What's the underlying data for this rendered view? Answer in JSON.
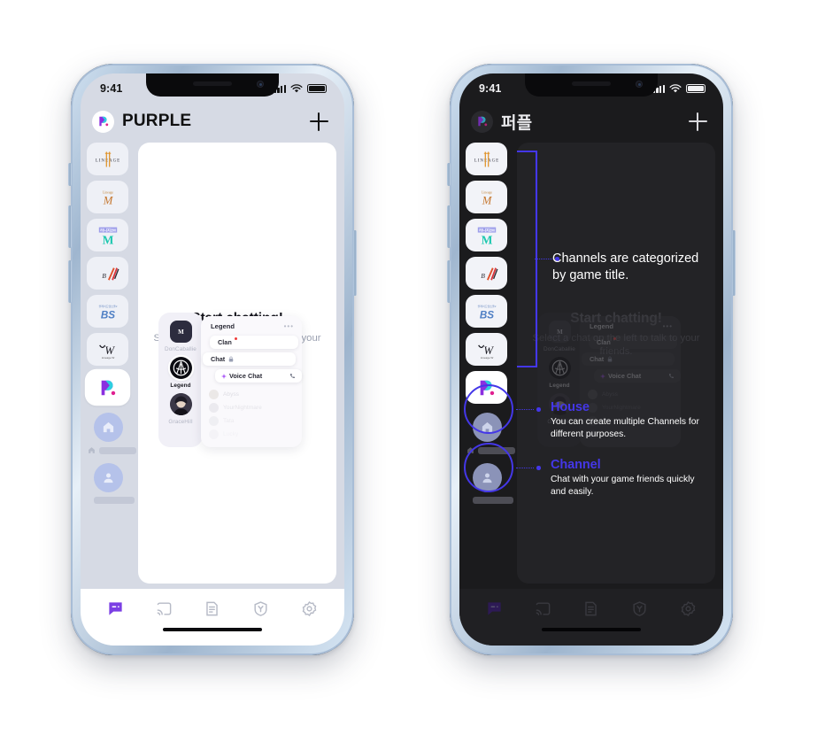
{
  "meta": {
    "accent_purple": "#7b3fe4",
    "accent_blue": "#4437e8",
    "light_bg": "#d6dae4",
    "dark_bg": "#1b1b1d"
  },
  "phones": [
    {
      "id": "light",
      "theme": "light",
      "status": {
        "time": "9:41",
        "signal_icon": "cellular-bars-icon",
        "wifi_icon": "wifi-icon",
        "battery_icon": "battery-icon"
      },
      "header": {
        "logo_icon": "purple-app-logo-icon",
        "title": "PURPLE",
        "add_icon": "plus-icon"
      },
      "rail": {
        "games": [
          {
            "name": "lineage",
            "label": "LINEAGE"
          },
          {
            "name": "lineage-m",
            "label": "Lineage M"
          },
          {
            "name": "lineage-2m",
            "label": "Lineage 2M"
          },
          {
            "name": "blade-and-soul",
            "label": "Blade & Soul"
          },
          {
            "name": "b-and-s-2",
            "label": "BS2"
          },
          {
            "name": "lineage-w",
            "label": "Lineage W"
          },
          {
            "name": "purple",
            "label": "PURPLE",
            "selected": true
          }
        ],
        "placeholders": [
          {
            "name": "house",
            "icon": "house-icon"
          },
          {
            "name": "channel",
            "icon": "person-icon"
          }
        ]
      },
      "empty_state": {
        "title": "Start chatting!",
        "body": "Select a chat on the left to talk to your friends."
      },
      "overlay": {
        "friends": [
          {
            "name": "DonCaballie",
            "avatar": "m-badge-avatar",
            "selected": false
          },
          {
            "name": "Legend",
            "avatar": "legend-crest-avatar",
            "selected": true
          },
          {
            "name": "GraceHill",
            "avatar": "gracehill-photo-avatar",
            "selected": false
          }
        ],
        "panel_title": "Legend",
        "more_icon": "more-horizontal-icon",
        "channels": [
          {
            "label": "Clan",
            "badge": true,
            "icon": null
          },
          {
            "label": "Chat",
            "badge": false,
            "icon": "lock-icon"
          },
          {
            "label": "Voice Chat",
            "badge": false,
            "icon": "sparkle-icon",
            "trailing_icon": "phone-call-icon"
          }
        ],
        "members": [
          "Abyss",
          "YourNightmare",
          "Tata",
          "Lucky"
        ]
      },
      "tabs": [
        {
          "name": "chat",
          "icon": "chat-bubble-icon",
          "active": true
        },
        {
          "name": "cast",
          "icon": "screen-cast-icon",
          "active": false
        },
        {
          "name": "board",
          "icon": "document-icon",
          "active": false
        },
        {
          "name": "guard",
          "icon": "shield-y-icon",
          "active": false
        },
        {
          "name": "settings",
          "icon": "gear-icon",
          "active": false
        }
      ]
    },
    {
      "id": "dark",
      "theme": "dark",
      "status": {
        "time": "9:41",
        "signal_icon": "cellular-bars-icon",
        "wifi_icon": "wifi-icon",
        "battery_icon": "battery-icon"
      },
      "header": {
        "logo_icon": "purple-app-logo-icon",
        "title": "퍼플",
        "add_icon": "plus-icon"
      },
      "rail": {
        "games": [
          {
            "name": "lineage",
            "label": "LINEAGE"
          },
          {
            "name": "lineage-m",
            "label": "Lineage M"
          },
          {
            "name": "lineage-2m",
            "label": "Lineage 2M"
          },
          {
            "name": "blade-and-soul",
            "label": "Blade & Soul"
          },
          {
            "name": "b-and-s-2",
            "label": "BS2"
          },
          {
            "name": "lineage-w",
            "label": "Lineage W"
          },
          {
            "name": "purple",
            "label": "PURPLE",
            "selected": true
          }
        ],
        "placeholders": [
          {
            "name": "house",
            "icon": "house-icon"
          },
          {
            "name": "channel",
            "icon": "person-icon"
          }
        ]
      },
      "empty_state": {
        "title": "Start chatting!",
        "body": "Select a chat on the left to talk to your friends."
      },
      "overlay": {
        "friends": [
          {
            "name": "DonCaballie",
            "avatar": "m-badge-avatar",
            "selected": false
          },
          {
            "name": "Legend",
            "avatar": "legend-crest-avatar",
            "selected": true
          },
          {
            "name": "GraceHill",
            "avatar": "gracehill-photo-avatar",
            "selected": false
          }
        ],
        "panel_title": "Legend",
        "more_icon": "more-horizontal-icon",
        "channels": [
          {
            "label": "Clan",
            "badge": true,
            "icon": null
          },
          {
            "label": "Chat",
            "badge": false,
            "icon": "lock-icon"
          },
          {
            "label": "Voice Chat",
            "badge": false,
            "icon": "sparkle-icon",
            "trailing_icon": "phone-call-icon"
          }
        ],
        "members": [
          "Abyss",
          "YourNightmare",
          "Tata",
          "Lucky"
        ]
      },
      "tabs": [
        {
          "name": "chat",
          "icon": "chat-bubble-icon",
          "active": true
        },
        {
          "name": "cast",
          "icon": "screen-cast-icon",
          "active": false
        },
        {
          "name": "board",
          "icon": "document-icon",
          "active": false
        },
        {
          "name": "guard",
          "icon": "shield-y-icon",
          "active": false
        },
        {
          "name": "settings",
          "icon": "gear-icon",
          "active": false
        }
      ]
    }
  ],
  "annotations": {
    "games": {
      "text": "Channels are categorized by game title."
    },
    "house": {
      "title": "House",
      "body": "You can create multiple Channels for different purposes."
    },
    "channel": {
      "title": "Channel",
      "body": "Chat with your game friends quickly and easily."
    }
  }
}
